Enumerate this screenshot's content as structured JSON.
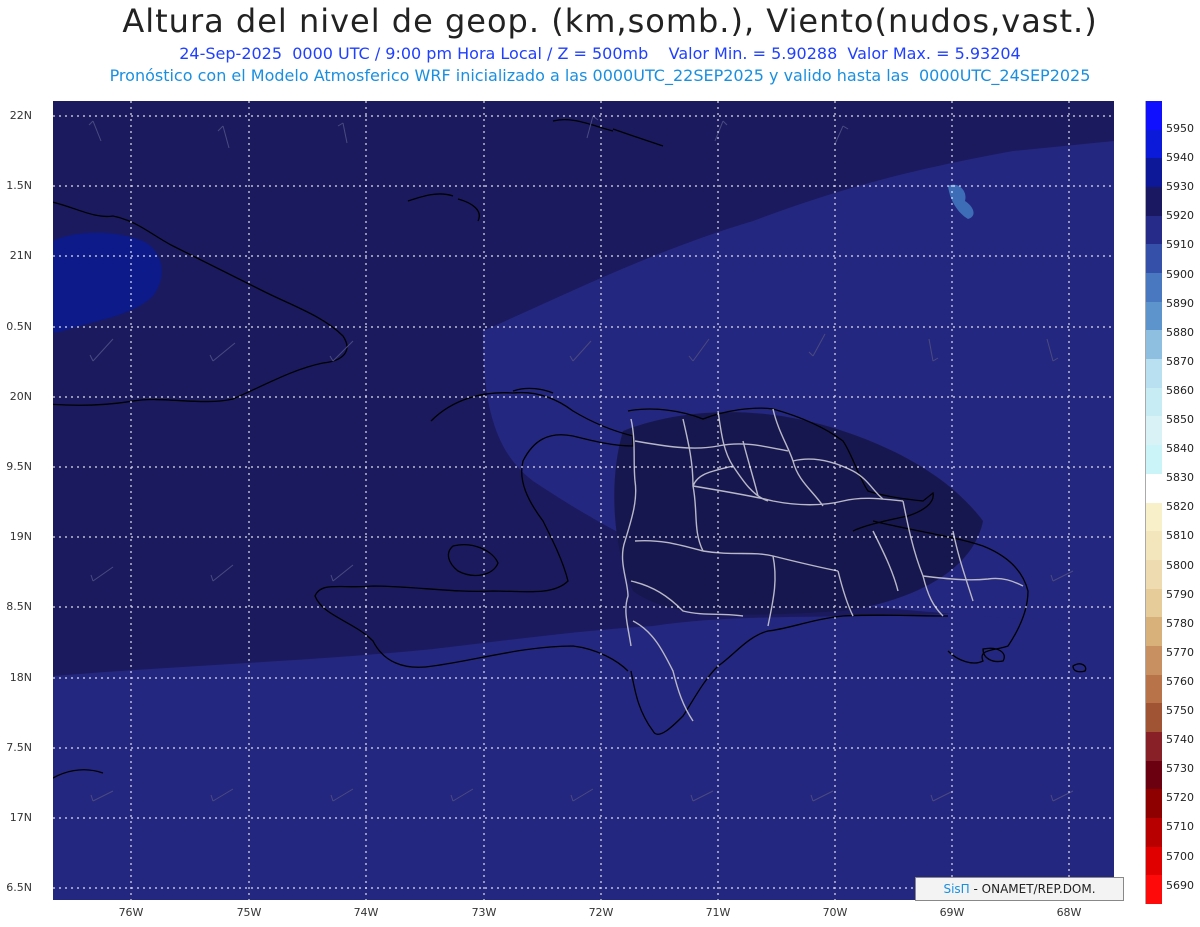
{
  "header": {
    "title": "Altura del nivel de geop. (km,somb.), Viento(nudos,vast.)",
    "line1": "24-Sep-2025  0000 UTC / 9:00 pm Hora Local / Z = 500mb    Valor Min. = 5.90288  Valor Max. = 5.93204",
    "line2": "Pronóstico con el Modelo Atmosferico WRF inicializado a las 0000UTC_22SEP2025 y valido hasta las  0000UTC_24SEP2025"
  },
  "axes": {
    "lat_labels": [
      "22N",
      "1.5N",
      "21N",
      "0.5N",
      "20N",
      "9.5N",
      "19N",
      "8.5N",
      "18N",
      "7.5N",
      "17N",
      "6.5N"
    ],
    "lon_labels": [
      "76W",
      "75W",
      "74W",
      "73W",
      "72W",
      "71W",
      "70W",
      "69W",
      "68W"
    ]
  },
  "legend": {
    "labels": [
      "5950",
      "5940",
      "5930",
      "5920",
      "5910",
      "5900",
      "5890",
      "5880",
      "5870",
      "5860",
      "5850",
      "5840",
      "5830",
      "5820",
      "5810",
      "5800",
      "5790",
      "5780",
      "5770",
      "5760",
      "5750",
      "5740",
      "5730",
      "5720",
      "5710",
      "5700",
      "5690"
    ],
    "colors": [
      "#1010ff",
      "#0a1ad8",
      "#0c1898",
      "#1a1860",
      "#262a88",
      "#3550a8",
      "#4a78c0",
      "#5d94cc",
      "#8fbfe0",
      "#b8e0f0",
      "#c8ecf4",
      "#d8f2f6",
      "#caf4f8",
      "#ffffff",
      "#f7f0c8",
      "#f4e6bc",
      "#eedcb0",
      "#e6cc98",
      "#d8b07a",
      "#c89060",
      "#b87448",
      "#a05434",
      "#882028",
      "#6a0010",
      "#8e0000",
      "#b80000",
      "#e00000",
      "#ff0a0a"
    ]
  },
  "credit": {
    "brand": "SisΠ",
    "text": " - ONAMET/REP.DOM."
  }
}
